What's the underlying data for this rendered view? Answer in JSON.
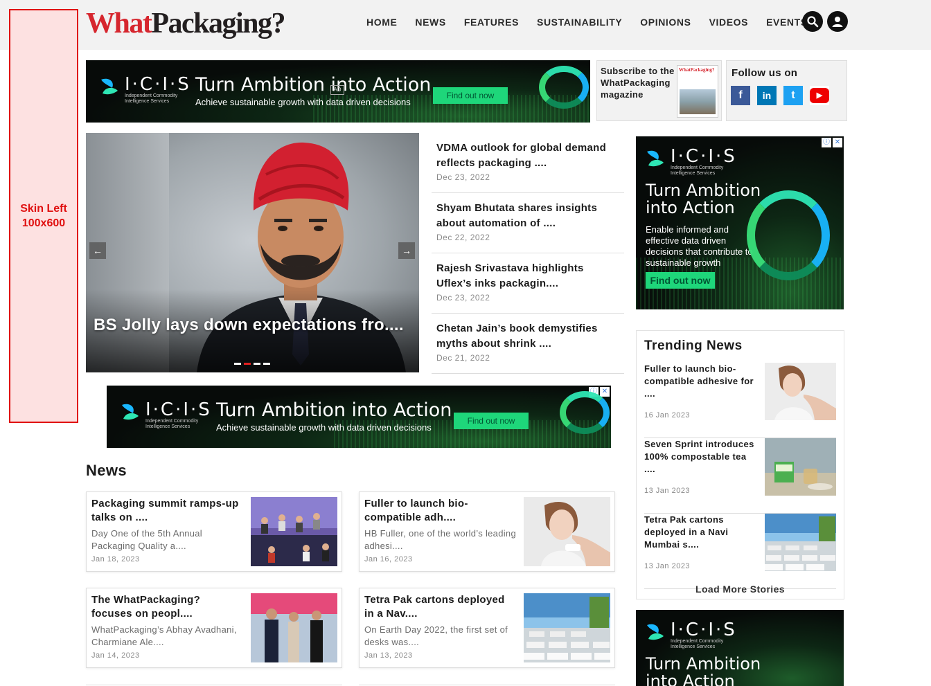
{
  "brand": {
    "part1": "What",
    "part2": "Packaging?"
  },
  "nav": [
    "HOME",
    "NEWS",
    "FEATURES",
    "SUSTAINABILITY",
    "OPINIONS",
    "VIDEOS",
    "EVENTS"
  ],
  "icons": {
    "search": "search-icon",
    "user": "user-icon"
  },
  "skin_left": "Skin Left\n100x600",
  "ad": {
    "brand": "I·C·I·S",
    "brand_sub": "Independent Commodity\nIntelligence Services",
    "headline": "Turn Ambition into Action",
    "headline_tall": "Turn Ambition\ninto Action",
    "sub": "Achieve sustainable growth with data driven decisions",
    "sub_tall": "Enable informed and effective data driven decisions that contribute to sustainable growth",
    "cta_wide": "Find out now",
    "cta_tall": "Find out now",
    "ad_badge": "AD"
  },
  "subscribe": {
    "text": "Subscribe to the WhatPackaging magazine",
    "mag_title": "WhatPackaging?"
  },
  "follow": {
    "title": "Follow us on",
    "networks": [
      "f",
      "in",
      "t",
      "▶"
    ]
  },
  "hero": {
    "title": "BS Jolly lays down expectations fro....",
    "prev": "←",
    "next": "→"
  },
  "headlines": [
    {
      "title": "VDMA outlook for global demand reflects packaging ....",
      "date": "Dec 23, 2022"
    },
    {
      "title": "Shyam Bhutata shares insights about automation of ....",
      "date": "Dec 22, 2022"
    },
    {
      "title": "Rajesh Srivastava highlights Uflex’s inks packagin....",
      "date": "Dec 23, 2022"
    },
    {
      "title": "Chetan Jain’s book demystifies myths about shrink ....",
      "date": "Dec 21, 2022"
    }
  ],
  "news": {
    "heading": "News",
    "cards": [
      {
        "title": "Packaging summit ramps-up talks on ....",
        "summary": "Day One of the 5th Annual Packaging Quality a....",
        "date": "Jan 18, 2023"
      },
      {
        "title": "Fuller to launch bio-compatible adh....",
        "summary": "HB Fuller, one of the world’s leading adhesi....",
        "date": "Jan 16, 2023"
      },
      {
        "title": "The WhatPackaging? focuses on peopl....",
        "summary": "WhatPackaging’s Abhay Avadhani, Charmiane Ale....",
        "date": "Jan 14, 2023"
      },
      {
        "title": "Tetra Pak cartons deployed in a Nav....",
        "summary": "On Earth Day 2022, the first set of desks was....",
        "date": "Jan 13, 2023"
      }
    ]
  },
  "trending": {
    "title": "Trending News",
    "items": [
      {
        "title": "Fuller to launch bio-compatible adhesive for ....",
        "date": "16 Jan 2023"
      },
      {
        "title": "Seven Sprint introduces 100% compostable tea ....",
        "date": "13 Jan 2023"
      },
      {
        "title": "Tetra Pak cartons deployed in a Navi Mumbai s....",
        "date": "13 Jan 2023"
      }
    ],
    "load_more": "Load More Stories"
  },
  "colors": {
    "brand_red": "#d6262e",
    "ad_green": "#1ed67a",
    "facebook": "#3b5998",
    "linkedin": "#0077b5",
    "twitter": "#1da1f2",
    "youtube": "#e00"
  }
}
